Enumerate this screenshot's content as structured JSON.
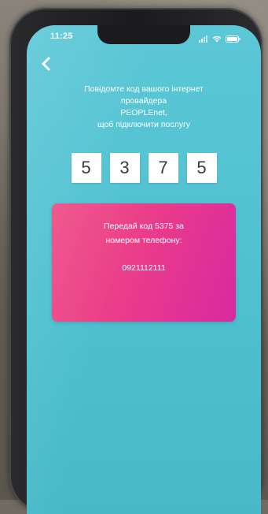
{
  "status_bar": {
    "time": "11:25",
    "signal_icon": "signal-bars-icon",
    "wifi_icon": "wifi-icon",
    "battery_icon": "battery-icon"
  },
  "navigation": {
    "back_icon": "chevron-left-icon"
  },
  "instruction": {
    "line1": "Повідомте код вашого інтернет",
    "line2": "провайдера",
    "line3": "PEOPLEnet,",
    "line4": "щоб підключити послугу"
  },
  "code": {
    "digits": [
      "5",
      "3",
      "7",
      "5"
    ]
  },
  "card": {
    "line1": "Передай код 5375 за",
    "line2": "номером телефону:",
    "phone": "0921112111",
    "colors": {
      "gradient_start": "#ef5a8c",
      "gradient_end": "#d829a0"
    }
  },
  "theme": {
    "background": "#4fc1d1",
    "text": "#ffffff"
  }
}
